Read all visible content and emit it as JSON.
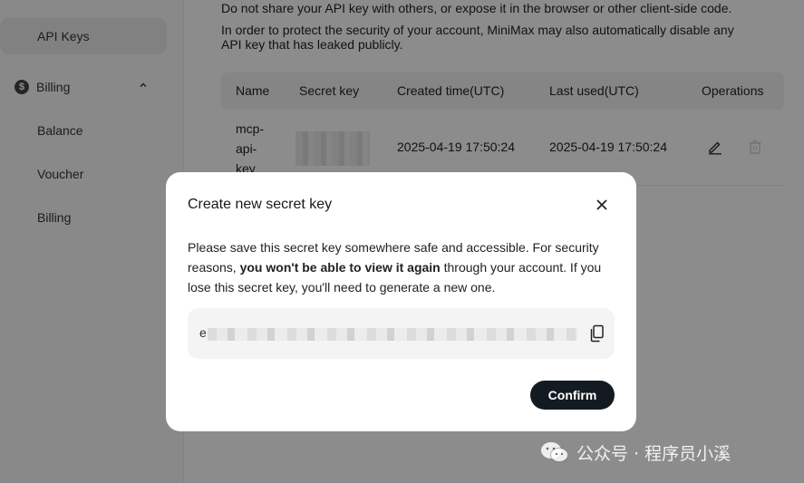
{
  "sidebar": {
    "api_keys": "API Keys",
    "billing": "Billing",
    "billing_icon_glyph": "$",
    "sub_items": [
      "Balance",
      "Voucher",
      "Billing"
    ]
  },
  "notes": {
    "line1": "Do not share your API key with others, or expose it in the browser or other client-side code.",
    "line2": "In order to protect the security of your account, MiniMax may also automatically disable any",
    "line3": "API key that has leaked publicly."
  },
  "table": {
    "headers": [
      "Name",
      "Secret key",
      "Created time(UTC)",
      "Last used(UTC)",
      "Operations"
    ],
    "row": {
      "name_lines": [
        "mcp-",
        "api-",
        "key"
      ],
      "created": "2025-04-19 17:50:24",
      "last_used": "2025-04-19 17:50:24"
    }
  },
  "modal": {
    "title": "Create new secret key",
    "body_part1": "Please save this secret key somewhere safe and accessible. For security reasons,",
    "body_bold": "you won't be able to view it again",
    "body_part2": "through your account. If you lose this secret key, you'll need to generate a new one.",
    "key_prefix": "e",
    "confirm_label": "Confirm"
  },
  "watermark": {
    "text": "公众号 · 程序员小溪"
  },
  "icons": {
    "edit": "edit-icon",
    "trash": "trash-icon",
    "close": "close-icon",
    "copy": "copy-icon",
    "chevron": "chevron-up-icon",
    "wechat": "wechat-icon"
  },
  "colors": {
    "confirm_bg": "#141a22",
    "overlay": "rgba(0,0,0,0.45)"
  }
}
